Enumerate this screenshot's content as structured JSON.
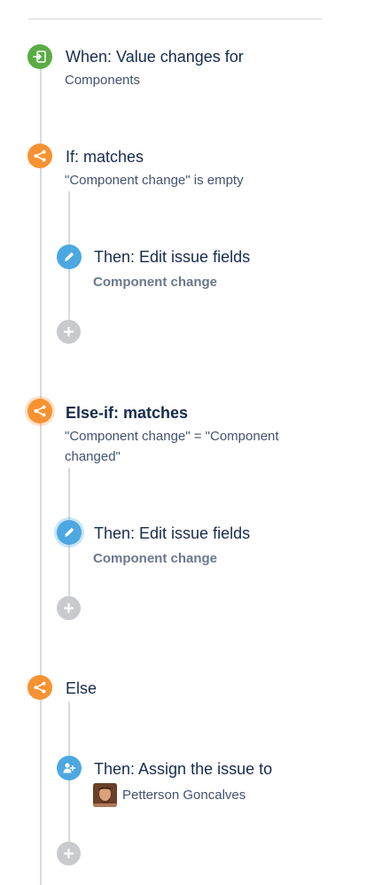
{
  "trigger": {
    "title": "When: Value changes for",
    "subtitle": "Components",
    "icon": "trigger-icon"
  },
  "if_block": {
    "title": "If: matches",
    "condition": "\"Component change\" is empty",
    "icon": "branch-icon",
    "action": {
      "title": "Then: Edit issue fields",
      "detail": "Component change",
      "icon": "pencil-icon"
    }
  },
  "elseif_block": {
    "title": "Else-if: matches",
    "condition_line1": "\"Component change\" = \"Component",
    "condition_line2": "changed\"",
    "icon": "branch-icon",
    "action": {
      "title": "Then: Edit issue fields",
      "detail": "Component change",
      "icon": "pencil-icon"
    }
  },
  "else_block": {
    "title": "Else",
    "icon": "branch-icon",
    "action": {
      "title": "Then: Assign the issue to",
      "assignee": "Petterson Goncalves",
      "icon": "assign-user-icon"
    }
  },
  "add_icon": "plus-icon",
  "colors": {
    "trigger": "#5aac44",
    "branch": "#f79232",
    "action": "#4ca8e0",
    "add": "#c8cace",
    "line": "#d8dbe0"
  }
}
